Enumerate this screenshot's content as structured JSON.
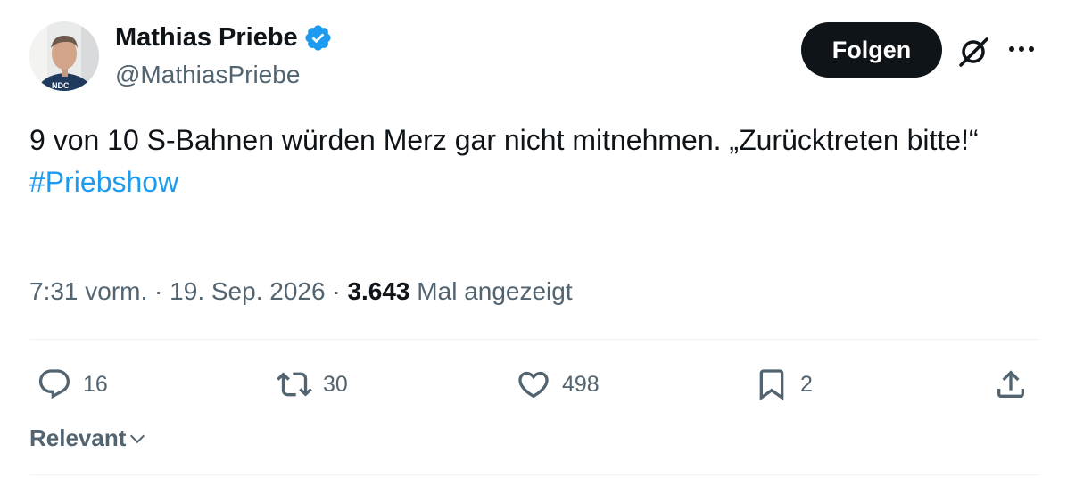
{
  "author": {
    "name": "Mathias Priebe",
    "handle": "@MathiasPriebe",
    "avatar_shirt_text": "NDC"
  },
  "follow_button": {
    "label": "Folgen"
  },
  "tweet": {
    "text": "9 von 10 S-Bahnen würden Merz gar nicht mitnehmen. „Zurücktreten bitte!“",
    "hashtag": "#Priebshow"
  },
  "meta": {
    "time": "7:31 vorm.",
    "separator1": " · ",
    "date": "19. Sep. 2026",
    "separator2": " · ",
    "views_count": "3.643",
    "views_label": " Mal angezeigt"
  },
  "actions": {
    "replies": "16",
    "reposts": "30",
    "likes": "498",
    "bookmarks": "2"
  },
  "sort": {
    "label": "Relevant"
  },
  "colors": {
    "text": "#0f1419",
    "secondary": "#536471",
    "accent": "#1d9bf0",
    "divider": "#eff3f4"
  },
  "icons": [
    "verified-badge-icon",
    "grok-icon",
    "more-icon",
    "reply-icon",
    "repost-icon",
    "like-icon",
    "bookmark-icon",
    "share-icon",
    "chevron-down-icon"
  ]
}
